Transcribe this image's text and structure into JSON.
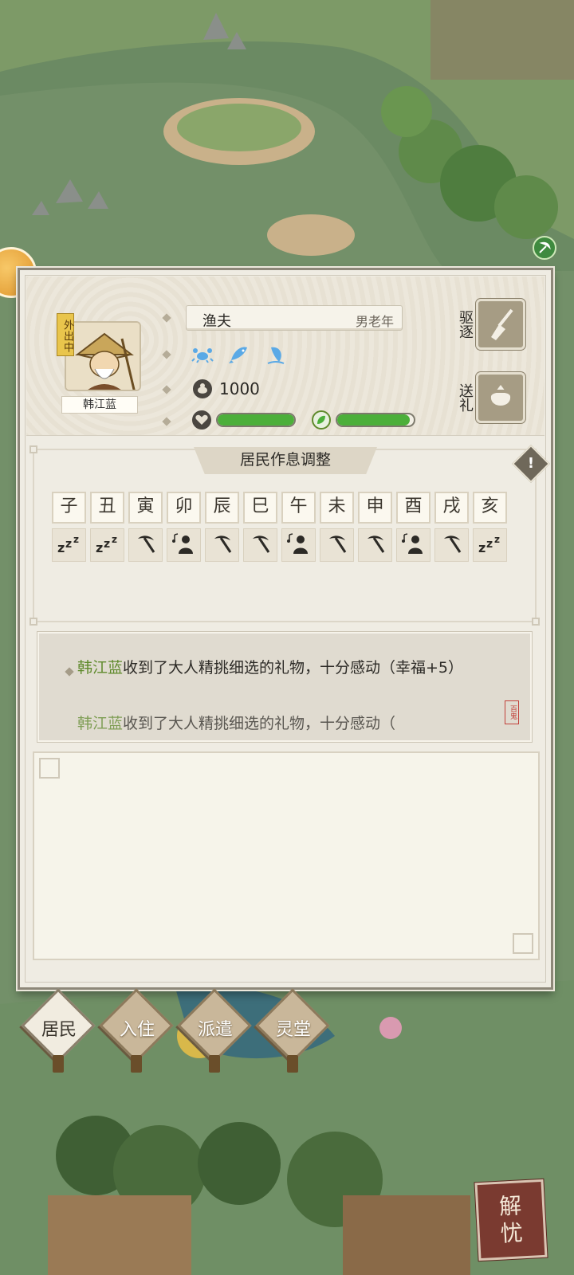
{
  "resident": {
    "status_badge": "外出中",
    "name": "韩江蓝",
    "occupation": "渔夫",
    "tags": "男老年",
    "traits": [
      "crab-icon",
      "fish-icon",
      "fish-jump-icon"
    ],
    "money": "1000",
    "health_fraction": 1.0,
    "happiness_fraction": 0.95
  },
  "actions": {
    "expel_label": "驱逐",
    "gift_label": "送礼"
  },
  "schedule": {
    "title": "居民作息调整",
    "hours": [
      "子",
      "丑",
      "寅",
      "卯",
      "辰",
      "巳",
      "午",
      "未",
      "申",
      "酉",
      "戌",
      "亥"
    ],
    "activities": [
      "sleep",
      "sleep",
      "work",
      "leisure",
      "work",
      "work",
      "leisure",
      "work",
      "work",
      "leisure",
      "work",
      "sleep"
    ]
  },
  "log": {
    "entries": [
      {
        "name": "韩江蓝",
        "text": "收到了大人精挑细选的礼物，十分感动（幸福+5）"
      },
      {
        "name": "韩江蓝",
        "text": "收到了大人精挑细选的礼物，十分感动（"
      }
    ],
    "seal_text": "百鬼"
  },
  "tabs": [
    {
      "label": "居民",
      "active": true
    },
    {
      "label": "入住",
      "active": false
    },
    {
      "label": "派遣",
      "active": false
    },
    {
      "label": "灵堂",
      "active": false
    }
  ],
  "corner_button": {
    "line1": "解",
    "line2": "忧"
  },
  "colors": {
    "bar_green": "#4caf3a",
    "name_green": "#5f8a2c",
    "panel_bg": "#efece3"
  }
}
